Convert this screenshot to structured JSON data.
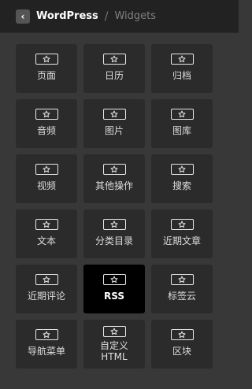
{
  "header": {
    "back_icon": "chevron-left-icon",
    "title": "WordPress",
    "separator": "/",
    "subtitle": "Widgets"
  },
  "widgets": [
    {
      "label": "页面",
      "icon": "star-icon"
    },
    {
      "label": "日历",
      "icon": "star-icon"
    },
    {
      "label": "归档",
      "icon": "star-icon"
    },
    {
      "label": "音频",
      "icon": "star-icon"
    },
    {
      "label": "图片",
      "icon": "star-icon"
    },
    {
      "label": "图库",
      "icon": "star-icon"
    },
    {
      "label": "视频",
      "icon": "star-icon"
    },
    {
      "label": "其他操作",
      "icon": "star-icon"
    },
    {
      "label": "搜索",
      "icon": "star-icon"
    },
    {
      "label": "文本",
      "icon": "star-icon"
    },
    {
      "label": "分类目录",
      "icon": "star-icon"
    },
    {
      "label": "近期文章",
      "icon": "star-icon"
    },
    {
      "label": "近期评论",
      "icon": "star-icon"
    },
    {
      "label": "RSS",
      "icon": "star-icon",
      "selected": true
    },
    {
      "label": "标签云",
      "icon": "star-icon"
    },
    {
      "label": "导航菜单",
      "icon": "star-icon"
    },
    {
      "label": "自定义\nHTML",
      "icon": "star-icon"
    },
    {
      "label": "区块",
      "icon": "star-icon"
    }
  ],
  "colors": {
    "background": "#383838",
    "header": "#222222",
    "tile": "#2b2b2b",
    "tile_selected": "#000000",
    "text": "#dddddd"
  }
}
